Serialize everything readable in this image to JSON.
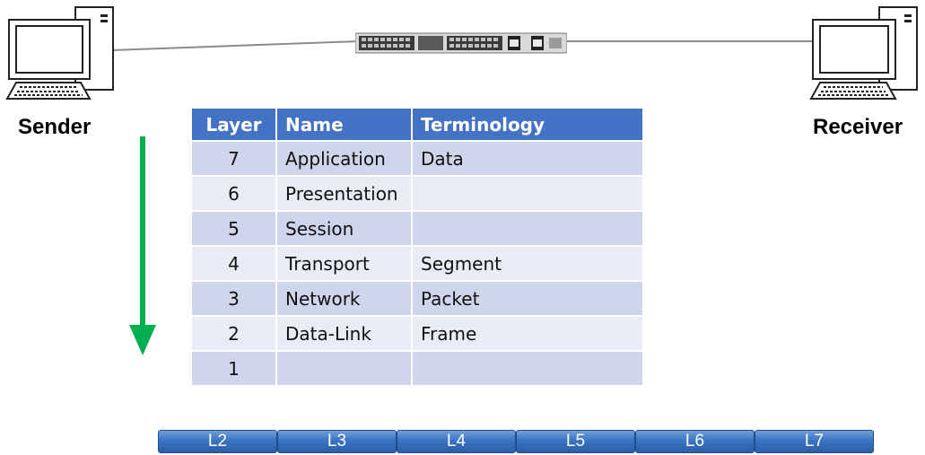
{
  "sender": {
    "label": "Sender"
  },
  "receiver": {
    "label": "Receiver"
  },
  "table": {
    "headers": [
      "Layer",
      "Name",
      "Terminology"
    ],
    "rows": [
      {
        "layer": "7",
        "name": "Application",
        "term": "Data"
      },
      {
        "layer": "6",
        "name": "Presentation",
        "term": ""
      },
      {
        "layer": "5",
        "name": "Session",
        "term": ""
      },
      {
        "layer": "4",
        "name": "Transport",
        "term": "Segment"
      },
      {
        "layer": "3",
        "name": "Network",
        "term": "Packet"
      },
      {
        "layer": "2",
        "name": "Data-Link",
        "term": "Frame"
      },
      {
        "layer": "1",
        "name": "",
        "term": ""
      }
    ]
  },
  "segments": [
    "L2",
    "L3",
    "L4",
    "L5",
    "L6",
    "L7"
  ],
  "colors": {
    "table_header": "#4472c4",
    "row_dark": "#cfd5ea",
    "row_light": "#e9ebf5",
    "arrow": "#00b050",
    "segment": "#3b74c2"
  }
}
